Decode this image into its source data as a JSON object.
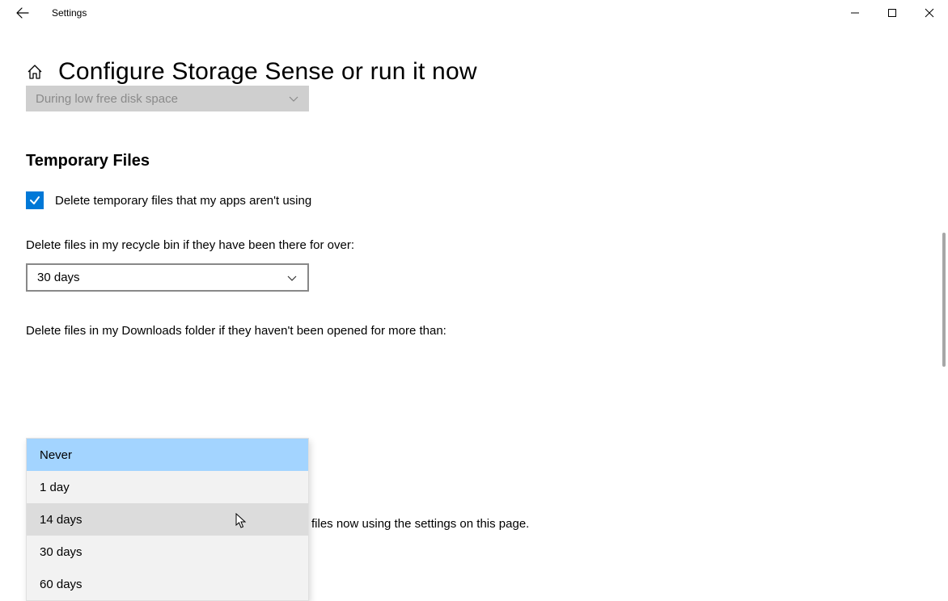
{
  "app_title": "Settings",
  "page_title": "Configure Storage Sense or run it now",
  "run_schedule": {
    "value": "During low free disk space"
  },
  "section_title": "Temporary Files",
  "checkbox_label": "Delete temporary files that my apps aren't using",
  "recycle_bin": {
    "label": "Delete files in my recycle bin if they have been there for over:",
    "value": "30 days"
  },
  "downloads": {
    "label": "Delete files in my Downloads folder if they haven't been opened for more than:",
    "options": [
      "Never",
      "1 day",
      "14 days",
      "30 days",
      "60 days"
    ]
  },
  "trailing_text": "files now using the settings on this page."
}
